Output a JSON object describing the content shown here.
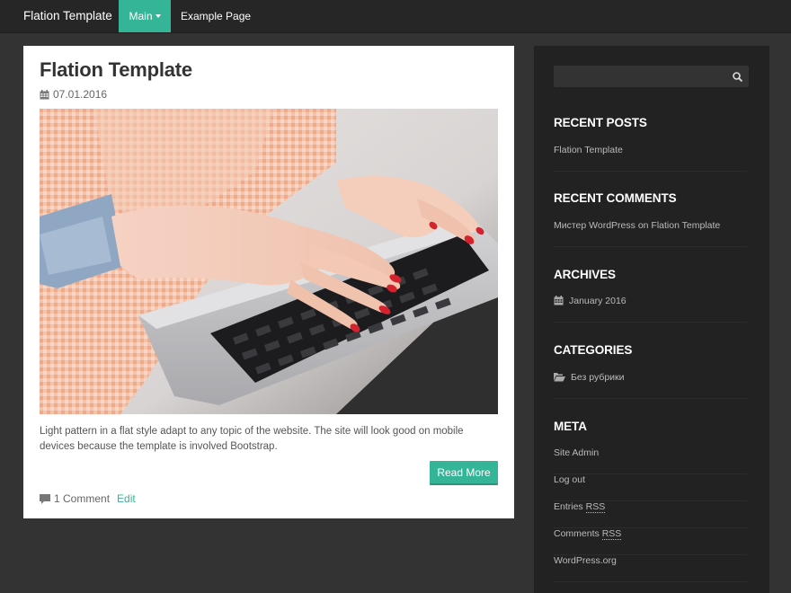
{
  "navbar": {
    "brand": "Flation Template",
    "items": [
      {
        "label": "Main",
        "active": true,
        "has_dropdown": true
      },
      {
        "label": "Example Page",
        "active": false,
        "has_dropdown": false
      }
    ]
  },
  "post": {
    "title": "Flation Template",
    "date": "07.01.2016",
    "date_icon": "calendar-icon",
    "image": "photo of hands with red nail polish typing on a laptop keyboard",
    "excerpt": "Light pattern in a flat style adapt to any topic of the website. The site will look good on mobile devices because the template is involved Bootstrap.",
    "read_more_label": "Read More",
    "comments_label": "1 Comment",
    "comments_icon": "comment-icon",
    "edit_label": "Edit"
  },
  "sidebar": {
    "search": {
      "value": "",
      "placeholder": "",
      "icon": "search-icon"
    },
    "recent_posts": {
      "title": "RECENT POSTS",
      "items": [
        "Flation Template"
      ]
    },
    "recent_comments": {
      "title": "RECENT COMMENTS",
      "items": [
        {
          "author": "Мистер WordPress",
          "on": "on",
          "post": "Flation Template"
        }
      ]
    },
    "archives": {
      "title": "ARCHIVES",
      "icon": "calendar-icon",
      "items": [
        "January 2016"
      ]
    },
    "categories": {
      "title": "CATEGORIES",
      "icon": "folder-open-icon",
      "items": [
        "Без рубрики"
      ]
    },
    "meta": {
      "title": "META",
      "items": [
        "Site Admin",
        "Log out",
        "Entries RSS",
        "Comments RSS",
        "WordPress.org"
      ],
      "entries_prefix": "Entries ",
      "comments_prefix": "Comments ",
      "rss": "RSS"
    }
  },
  "colors": {
    "accent": "#35b597",
    "page_bg": "#333333",
    "navbar_bg": "#262626",
    "sidebar_bg": "#222222",
    "card_bg": "#ffffff"
  }
}
